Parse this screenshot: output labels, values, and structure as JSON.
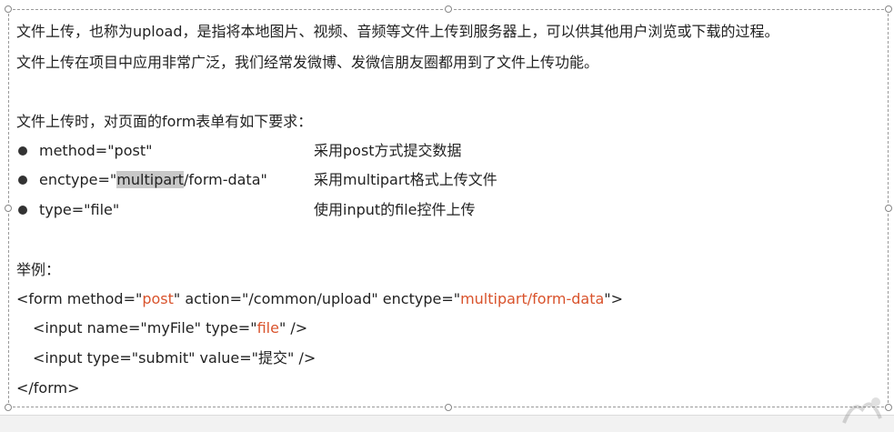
{
  "paragraph1": "文件上传，也称为upload，是指将本地图片、视频、音频等文件上传到服务器上，可以供其他用户浏览或下载的过程。",
  "paragraph2": "文件上传在项目中应用非常广泛，我们经常发微博、发微信朋友圈都用到了文件上传功能。",
  "requirements_title": "文件上传时，对页面的form表单有如下要求：",
  "requirements": [
    {
      "attr": "method=\"post\"",
      "desc": "采用post方式提交数据"
    },
    {
      "attr_prefix": "enctype=\"",
      "attr_highlight": "multipart",
      "attr_suffix": "/form-data\"",
      "desc": "采用multipart格式上传文件"
    },
    {
      "attr": "type=\"file\"",
      "desc": "使用input的file控件上传"
    }
  ],
  "example_title": "举例：",
  "code": {
    "line1": {
      "a": "<form method=\"",
      "b": "post",
      "c": "\" action=\"/common/upload\" enctype=\"",
      "d": "multipart/form-data",
      "e": "\">"
    },
    "line2": {
      "a": "<input name=\"myFile\" type=\"",
      "b": "file",
      "c": "\"  />"
    },
    "line3": "<input type=\"submit\" value=\"提交\" />",
    "line4": "</form>"
  },
  "colors": {
    "keyword": "#d9532c",
    "highlight": "#c8c8c8",
    "text": "#222222"
  }
}
